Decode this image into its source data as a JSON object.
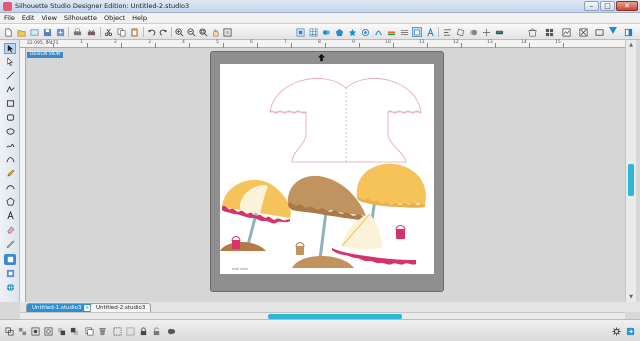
{
  "window": {
    "title": "Silhouette Studio Designer Edition: Untitled-2.studio3",
    "minimize": "–",
    "maximize": "□",
    "close": "✕"
  },
  "menu": [
    "File",
    "Edit",
    "View",
    "Silhouette",
    "Object",
    "Help"
  ],
  "ruler": {
    "zoom_readout": "22.095, 0.471",
    "ticks": [
      "0",
      "1",
      "2",
      "3",
      "4",
      "5",
      "6",
      "7",
      "8",
      "9",
      "10",
      "11",
      "12",
      "13",
      "14",
      "15"
    ]
  },
  "canvas": {
    "view_label": "DESIGN VIEW",
    "mat_note": "mat note",
    "artwork": [
      "umbrella-outline-cut-path",
      "yellow-cream-beach-umbrella",
      "brown-beach-umbrella",
      "yellow-beach-umbrella",
      "cream-umbrella-half-with-pink-scallop",
      "pink-pail",
      "sand-mound"
    ]
  },
  "tabs": [
    {
      "label": "Untitled-1.studio3",
      "active": true,
      "close": "x"
    },
    {
      "label": "Untitled-2.studio3",
      "active": false
    }
  ],
  "colors": {
    "accent": "#2fb7d8",
    "selected_tab": "#2f8fcf",
    "cut_line": "#e7a3b0",
    "umbrella_yellow": "#f6c35a",
    "umbrella_cream": "#fbf2da",
    "umbrella_brown": "#c1935f",
    "scallop_pink": "#d6336a",
    "pole_blue": "#8fb1bd",
    "sand": "#b47a45"
  }
}
